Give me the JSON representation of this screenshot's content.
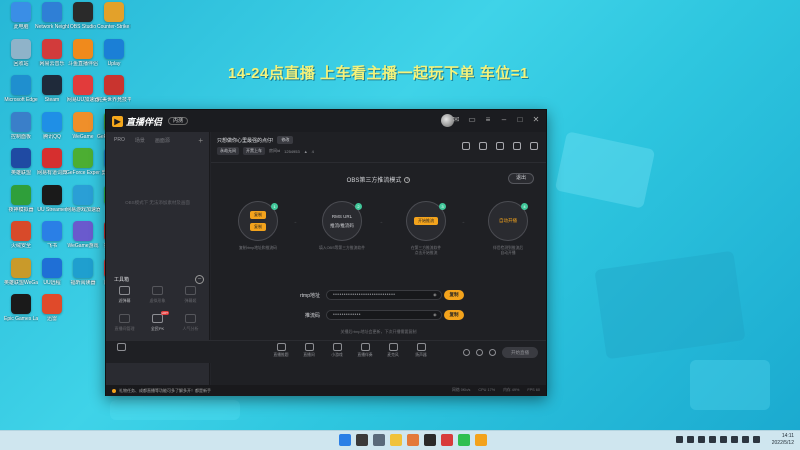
{
  "banner": "14-24点直播    上车看主播一起玩下单  车位=1",
  "desktop_icons": [
    {
      "label": "此电脑",
      "color": "#3a8ee6"
    },
    {
      "label": "Network Neighbor...",
      "color": "#2f7fd6"
    },
    {
      "label": "OBS Studio",
      "color": "#2a2a2a"
    },
    {
      "label": "Counter-Strike Global...",
      "color": "#e3a12a"
    },
    {
      "label": "回收站",
      "color": "#8fb3c9"
    },
    {
      "label": "网易云音乐",
      "color": "#d23b3b"
    },
    {
      "label": "斗鱼直播伴侣",
      "color": "#f08a1c"
    },
    {
      "label": "Uplay",
      "color": "#1b7fd6"
    },
    {
      "label": "Microsoft Edge",
      "color": "#1f8fcf"
    },
    {
      "label": "Steam",
      "color": "#1f2a3a"
    },
    {
      "label": "网易UU加速器",
      "color": "#e23b3b"
    },
    {
      "label": "完美世界竞技平台",
      "color": "#c9342f"
    },
    {
      "label": "控制面板",
      "color": "#3a7fc9"
    },
    {
      "label": "腾讯QQ",
      "color": "#1f8fe6"
    },
    {
      "label": "WeGame",
      "color": "#ef8f2a"
    },
    {
      "label": "GeForce Experience",
      "color": "#3fa33a"
    },
    {
      "label": "英雄联盟",
      "color": "#1f4aa3"
    },
    {
      "label": "网易有道词典",
      "color": "#d62f2f"
    },
    {
      "label": "GeForce Experience",
      "color": "#4cae32"
    },
    {
      "label": "剪映专业版",
      "color": "#1b8bd6"
    },
    {
      "label": "夜神模拟器",
      "color": "#2f9f3a"
    },
    {
      "label": "UU Streamer",
      "color": "#1a1a1a"
    },
    {
      "label": "网易游戏加速器",
      "color": "#2a9fd6"
    },
    {
      "label": "微信",
      "color": "#2fbf4f"
    },
    {
      "label": "火绒安全",
      "color": "#d84a2a"
    },
    {
      "label": "飞书",
      "color": "#2a7fe6"
    },
    {
      "label": "WeGame游戏",
      "color": "#6a5acd"
    },
    {
      "label": "招商银行",
      "color": "#c92f2f"
    },
    {
      "label": "英雄联盟WeGame版",
      "color": "#c99a2a"
    },
    {
      "label": "UU远程",
      "color": "#1f6fd6"
    },
    {
      "label": "福昕阅读器",
      "color": "#1f9fcf"
    },
    {
      "label": "网易大神",
      "color": "#e23b3b"
    },
    {
      "label": "Epic Games Launcher",
      "color": "#1a1a1a"
    },
    {
      "label": "迅雷",
      "color": "#e04a2a"
    }
  ],
  "app": {
    "name": "直播伴侣",
    "badge": "内测",
    "left_tabs": [
      "PRO",
      "场景",
      "画面源"
    ],
    "left_empty": "OBS模式下 无法添加素材及画面",
    "tools_title": "工具箱",
    "tools": [
      {
        "label": "滤弹幕",
        "dim": false,
        "tag": ""
      },
      {
        "label": "虚拟形象",
        "dim": true,
        "tag": ""
      },
      {
        "label": "弹幕姬",
        "dim": true,
        "tag": ""
      },
      {
        "label": "直播间管理",
        "dim": true,
        "tag": ""
      },
      {
        "label": "全民PK",
        "dim": false,
        "tag": "HOT"
      },
      {
        "label": "人气分析",
        "dim": true,
        "tag": ""
      },
      {
        "label": "上车一起玩",
        "dim": false,
        "tag": ""
      },
      {
        "label": "主播一起玩",
        "dim": false,
        "tag": ""
      },
      {
        "label": "发现",
        "dim": false,
        "tag": ""
      }
    ],
    "stream_title": "只想做你心里最强的点仔!",
    "edit": "修改",
    "chip_1": "永劫无间",
    "chip_2": "开黑上车",
    "meta_id": "房间id",
    "meta_num": "1254953",
    "meta_hot": "4",
    "obs_title": "OBS第三方推流模式",
    "exit": "退出",
    "steps": [
      {
        "num": "1",
        "center": "复制",
        "center2": "复制",
        "desc": "复制rtmp地址和推流码",
        "style": "pills"
      },
      {
        "num": "2",
        "center": "RMS URL",
        "center2": "推流/推流码",
        "desc": "填入OBS等第三方推流软件",
        "style": "text"
      },
      {
        "num": "3",
        "center": "开始推流",
        "center2": "",
        "desc": "在第三方推流软件\n点击开始推流",
        "style": "pill-one"
      },
      {
        "num": "4",
        "center": "自动开播",
        "center2": "",
        "desc": "伴侣检测到推流后\n自动开播",
        "style": "orange"
      }
    ],
    "rtmp_label": "rtmp地址",
    "rtmp_value": "•••••••••••••••••••••••••••••",
    "key_label": "推流码",
    "key_value": "•••••••••••••",
    "copy": "复制",
    "warning": "关播后rtmp地址会更新，下次开播需要复制",
    "bottom_tools": [
      "直播推题",
      "直播间",
      "小游戏",
      "直播伴奏",
      "麦克风",
      "扬声器"
    ],
    "start": "开始直播",
    "status_msg": "礼物任务、成都直播等功能可多了解多开！都是新手",
    "status_stats": [
      "网络 0Kb/s",
      "CPU 17%",
      "内存 49%",
      "FPS 60"
    ]
  },
  "clock": {
    "time": "14:11",
    "date": "2022/5/12"
  }
}
